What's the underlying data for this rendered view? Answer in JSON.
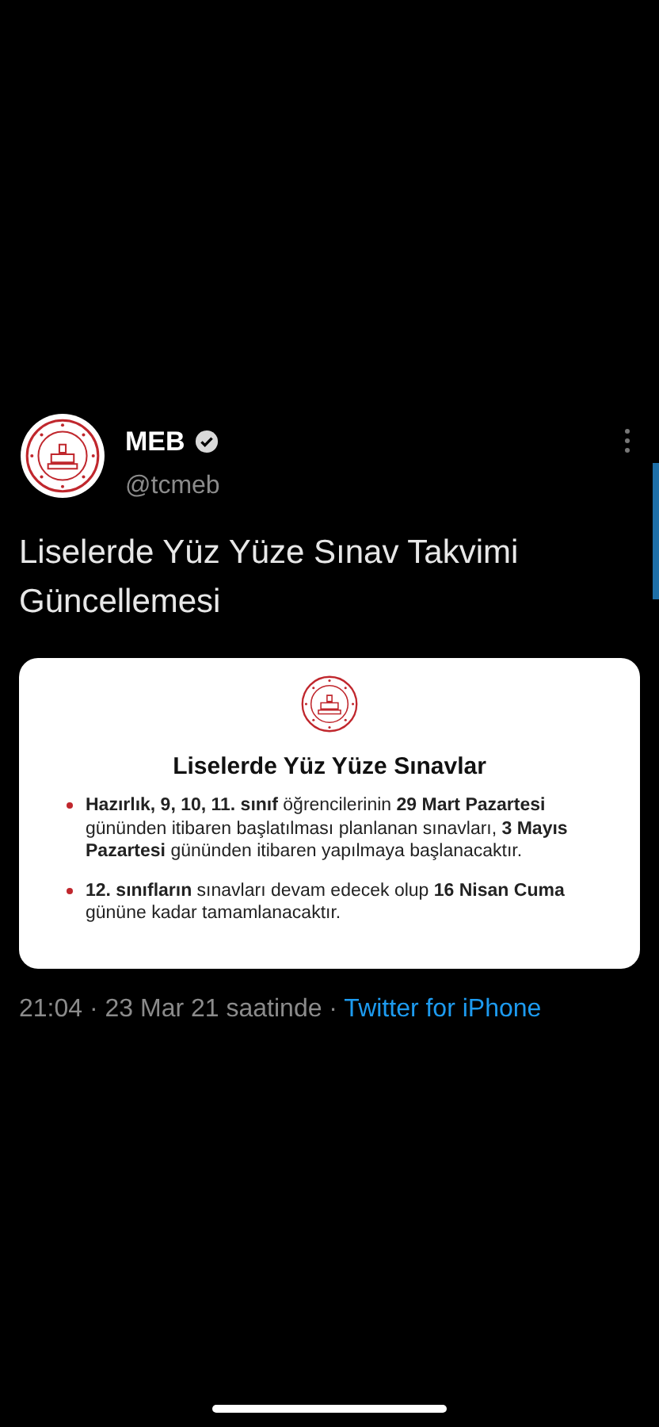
{
  "tweet": {
    "author": {
      "name": "MEB",
      "verified": true,
      "handle": "@tcmeb"
    },
    "text": "Liselerde Yüz Yüze Sınav Takvimi Güncellemesi",
    "card": {
      "heading": "Liselerde Yüz Yüze Sınavlar",
      "bullets": [
        {
          "text": "**Hazırlık, 9, 10, 11. sınıf** öğrencilerinin **29 Mart Pazartesi** gününden itibaren başlatılması planlanan sınavları, **3 Mayıs Pazartesi** gününden itibaren yapılmaya başlanacaktır."
        },
        {
          "text": "**12. sınıfların** sınavları devam edecek olup  **16 Nisan Cuma** gününe kadar tamamlanacaktır."
        }
      ]
    },
    "timestamp": "21:04 · 23 Mar 21 saatinde ·",
    "source": "Twitter for iPhone"
  }
}
